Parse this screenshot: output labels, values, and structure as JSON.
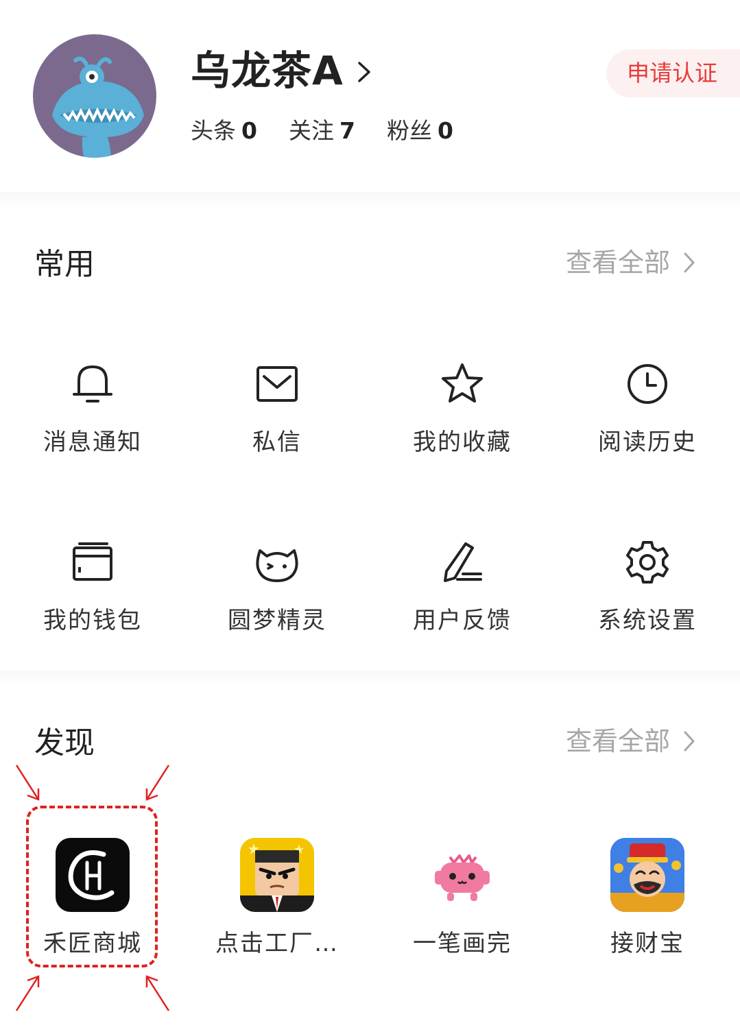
{
  "profile": {
    "username": "乌龙茶A",
    "stats": [
      {
        "label": "头条",
        "value": "0"
      },
      {
        "label": "关注",
        "value": "7"
      },
      {
        "label": "粉丝",
        "value": "0"
      }
    ],
    "verify_label": "申请认证"
  },
  "common": {
    "title": "常用",
    "view_all": "查看全部",
    "items": [
      {
        "label": "消息通知",
        "icon": "bell-icon"
      },
      {
        "label": "私信",
        "icon": "mail-icon"
      },
      {
        "label": "我的收藏",
        "icon": "star-icon"
      },
      {
        "label": "阅读历史",
        "icon": "clock-icon"
      },
      {
        "label": "我的钱包",
        "icon": "wallet-icon"
      },
      {
        "label": "圆梦精灵",
        "icon": "cat-face-icon"
      },
      {
        "label": "用户反馈",
        "icon": "pen-icon"
      },
      {
        "label": "系统设置",
        "icon": "gear-icon"
      }
    ]
  },
  "discover": {
    "title": "发现",
    "view_all": "查看全部",
    "apps": [
      {
        "label": "禾匠商城",
        "icon": "hejiang-logo-icon"
      },
      {
        "label": "点击工厂…",
        "icon": "click-factory-icon"
      },
      {
        "label": "一笔画完",
        "icon": "pink-cat-icon"
      },
      {
        "label": "接财宝",
        "icon": "fortune-god-icon"
      }
    ]
  },
  "colors": {
    "accent_red": "#e83b3b",
    "muted_text": "#a6a6a6",
    "annotation_red": "#e02020"
  }
}
